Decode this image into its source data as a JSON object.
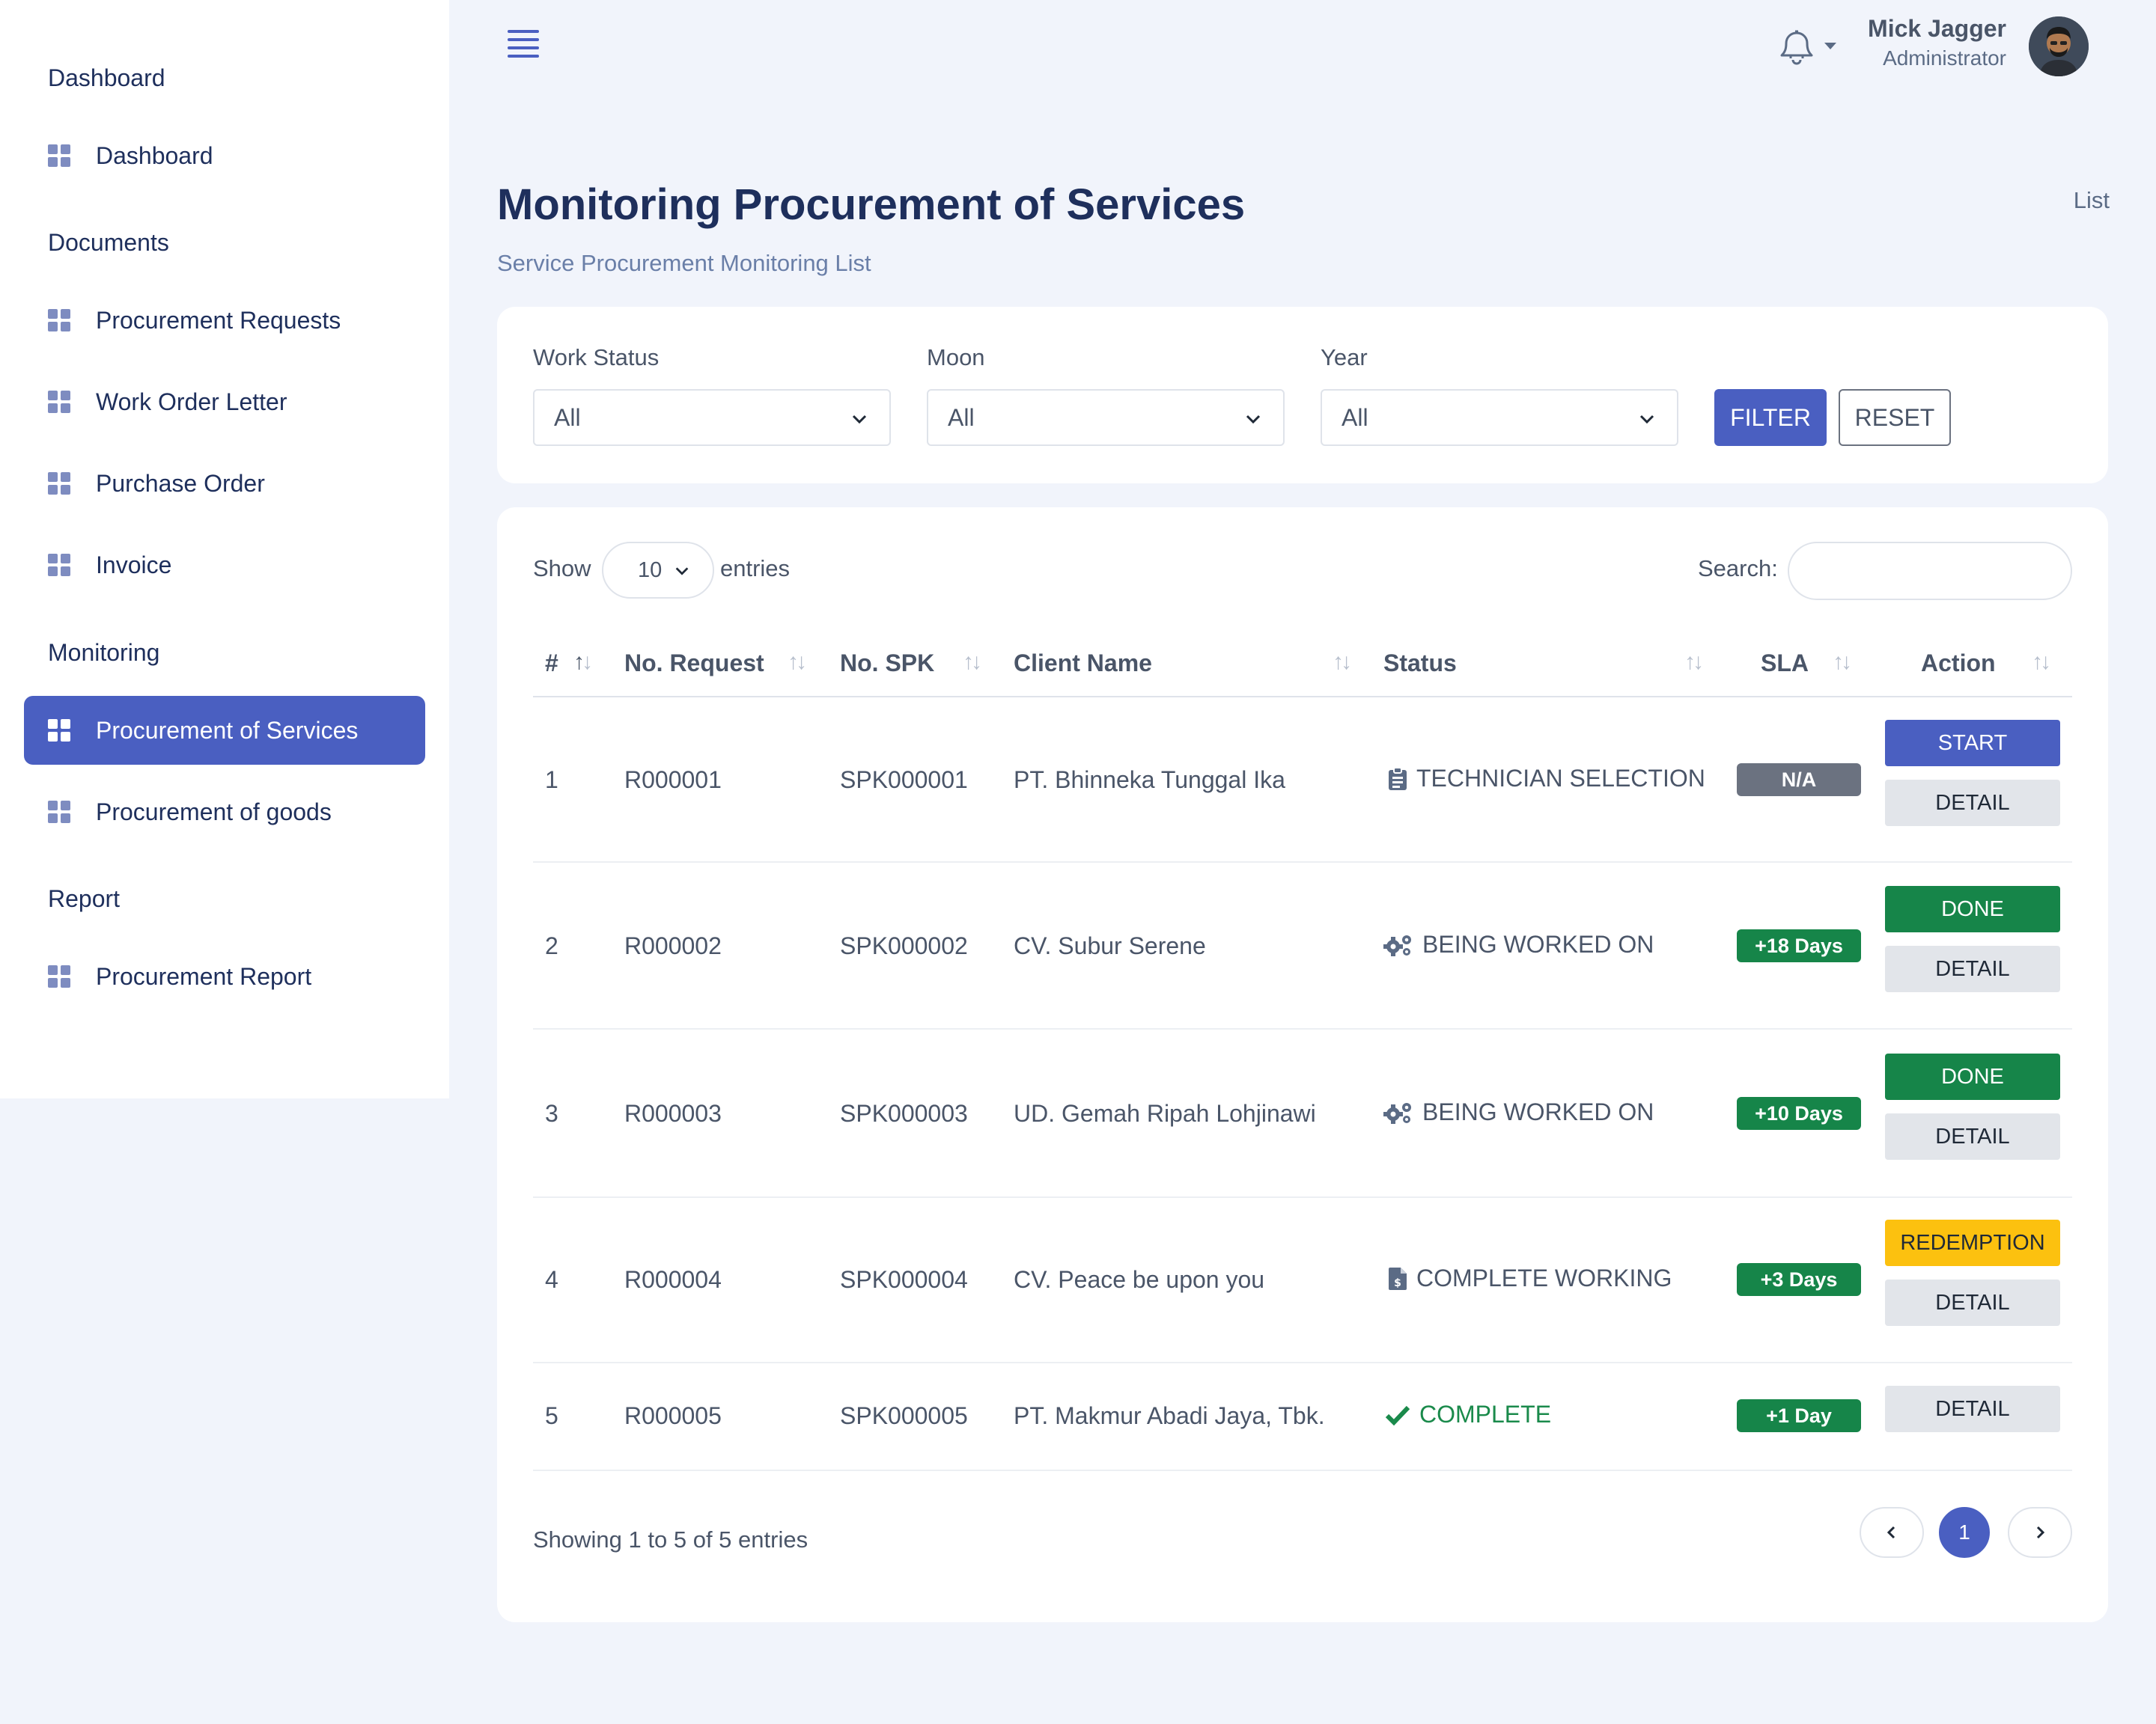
{
  "sidebar": {
    "sections": [
      {
        "label": "Dashboard",
        "items": [
          {
            "label": "Dashboard"
          }
        ]
      },
      {
        "label": "Documents",
        "items": [
          {
            "label": "Procurement Requests"
          },
          {
            "label": "Work Order Letter"
          },
          {
            "label": "Purchase Order"
          },
          {
            "label": "Invoice"
          }
        ]
      },
      {
        "label": "Monitoring",
        "items": [
          {
            "label": "Procurement of Services",
            "active": true
          },
          {
            "label": "Procurement of goods"
          }
        ]
      },
      {
        "label": "Report",
        "items": [
          {
            "label": "Procurement Report"
          }
        ]
      }
    ]
  },
  "header": {
    "user_name": "Mick Jagger",
    "user_role": "Administrator"
  },
  "page": {
    "title": "Monitoring Procurement of Services",
    "subtitle": "Service Procurement Monitoring List",
    "breadcrumb": "List"
  },
  "filters": {
    "work_status": {
      "label": "Work Status",
      "value": "All"
    },
    "moon": {
      "label": "Moon",
      "value": "All"
    },
    "year": {
      "label": "Year",
      "value": "All"
    },
    "filter_button": "FILTER",
    "reset_button": "RESET"
  },
  "table": {
    "show_label": "Show",
    "entries_value": "10",
    "entries_label": "entries",
    "search_label": "Search:",
    "search_value": "",
    "columns": [
      "#",
      "No. Request",
      "No. SPK",
      "Client Name",
      "Status",
      "SLA",
      "Action"
    ],
    "rows": [
      {
        "no": "1",
        "request": "R000001",
        "spk": "SPK000001",
        "client": "PT. Bhinneka Tunggal Ika",
        "status": "TECHNICIAN SELECTION",
        "status_icon": "clipboard-icon",
        "sla": "N/A",
        "sla_color": "#6b7280",
        "action": "START",
        "detail": "DETAIL"
      },
      {
        "no": "2",
        "request": "R000002",
        "spk": "SPK000002",
        "client": "CV. Subur Serene",
        "status": "BEING WORKED ON",
        "status_icon": "gears-icon",
        "sla": "+18 Days",
        "sla_color": "#168549",
        "action": "DONE",
        "detail": "DETAIL"
      },
      {
        "no": "3",
        "request": "R000003",
        "spk": "SPK000003",
        "client": "UD. Gemah Ripah Lohjinawi",
        "status": "BEING WORKED ON",
        "status_icon": "gears-icon",
        "sla": "+10 Days",
        "sla_color": "#168549",
        "action": "DONE",
        "detail": "DETAIL"
      },
      {
        "no": "4",
        "request": "R000004",
        "spk": "SPK000004",
        "client": "CV. Peace be upon you",
        "status": "COMPLETE WORKING",
        "status_icon": "invoice-file-icon",
        "sla": "+3 Days",
        "sla_color": "#168549",
        "action": "REDEMPTION",
        "detail": "DETAIL"
      },
      {
        "no": "5",
        "request": "R000005",
        "spk": "SPK000005",
        "client": "PT. Makmur Abadi Jaya, Tbk.",
        "status": "COMPLETE",
        "status_icon": "check-icon",
        "sla": "+1 Day",
        "sla_color": "#168549",
        "action": "",
        "detail": "DETAIL"
      }
    ],
    "showing_text": "Showing 1 to 5 of 5 entries",
    "current_page": "1"
  },
  "colors": {
    "accent": "#4a5fc1",
    "success": "#168549",
    "warning": "#fcc10f",
    "sidebar_text": "#1e2f5c"
  }
}
